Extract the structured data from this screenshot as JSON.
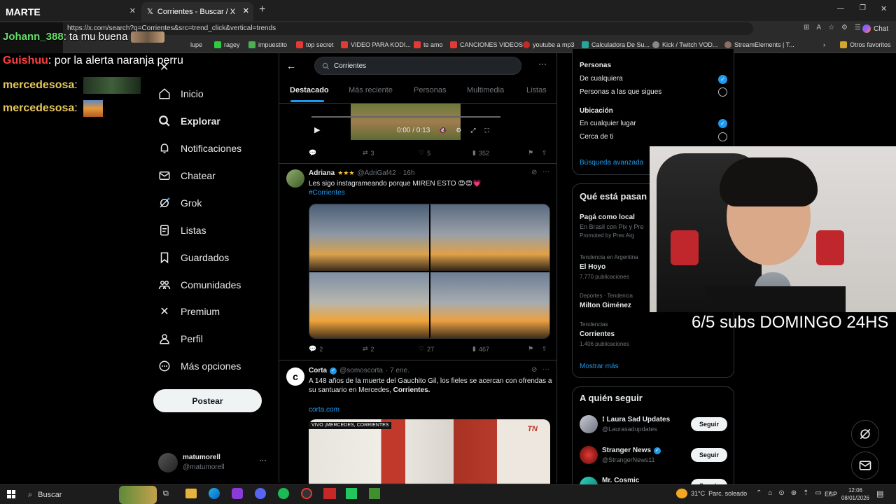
{
  "browser": {
    "tab1_title": "MARTE",
    "tab2_title": "Corrientes - Buscar / X",
    "url": "https://x.com/search?q=Corrientes&src=trend_click&vertical=trends",
    "bookmarks": [
      "lupe",
      "ragey",
      "impuestito",
      "top secret",
      "VIDEO PARA KODI...",
      "te amo",
      "CANCIONES VIDEOS",
      "youtube a mp3",
      "Calculadora De Su...",
      "Kick / Twitch VOD...",
      "StreamElements | T..."
    ],
    "other_favorites": "Otros favoritos",
    "chat_button": "Chat"
  },
  "overlay_chat": [
    {
      "user": "Johann_388",
      "text": ": ta mu buena",
      "color": "#66e06a"
    },
    {
      "user": "Guishuu",
      "text": ": por la alerta naranja perru",
      "color": "#ff4040"
    },
    {
      "user": "mercedesosa",
      "text": ":",
      "color": "#e5c75c"
    },
    {
      "user": "mercedesosa",
      "text": ":",
      "color": "#e5c75c"
    }
  ],
  "webcam_caption": "6/5 subs DOMINGO 24HS",
  "nav": {
    "items": [
      "Inicio",
      "Explorar",
      "Notificaciones",
      "Chatear",
      "Grok",
      "Listas",
      "Guardados",
      "Comunidades",
      "Premium",
      "Perfil",
      "Más opciones"
    ],
    "post_button": "Postear",
    "user_name": "matumorell",
    "user_handle": "@matumorell"
  },
  "search": {
    "query": "Corrientes",
    "tabs": [
      "Destacado",
      "Más reciente",
      "Personas",
      "Multimedia",
      "Listas"
    ]
  },
  "video": {
    "time": "0:00 / 0:13"
  },
  "tweet0_stats": {
    "retweets": "3",
    "likes": "5",
    "views": "352"
  },
  "tweet1": {
    "name": "Adriana",
    "handle": "@AdriGaf42",
    "time": "· 16h",
    "text": "Les sigo instagrameando porque MIREN ESTO 😍😍💗",
    "hashtag": "#Corrientes",
    "replies": "2",
    "retweets": "2",
    "likes": "27",
    "views": "467"
  },
  "tweet2": {
    "name": "Corta",
    "handle": "@somoscorta",
    "time": "· 7 ene.",
    "text_a": "A 148 años de la muerte del Gauchito Gil, los fieles se acercan con ofrendas a su santuario en Mercedes,",
    "text_b": "Corrientes.",
    "link": "corta.com",
    "video_banner": "VIVO ¡MERCEDES, CORRIENTES"
  },
  "filters": {
    "people_title": "Personas",
    "people_opt1": "De cualquiera",
    "people_opt2": "Personas a las que sigues",
    "location_title": "Ubicación",
    "location_opt1": "En cualquier lugar",
    "location_opt2": "Cerca de ti",
    "advanced": "Búsqueda avanzada"
  },
  "trends": {
    "title": "Qué está pasan",
    "promo_title": "Pagá como local",
    "promo_desc": "En Brasil con Pix y Pre",
    "promo_by": "Promoted by Prex Arg",
    "t1_context": "Tendencia en Argentina",
    "t1_name": "El Hoyo",
    "t1_count": "7.770 publicaciones",
    "t2_context": "Deportes · Tendencia",
    "t2_name": "Milton Giménez",
    "t3_context": "Tendencias",
    "t3_name": "Corrientes",
    "t3_count": "1.406 publicaciones",
    "show_more": "Mostrar más"
  },
  "follow": {
    "title": "A quién seguir",
    "people": [
      {
        "name": "⁝ Laura Sad Updates",
        "handle": "@Laurasadupdates",
        "button": "Seguir"
      },
      {
        "name": "Stranger News",
        "handle": "@StrangerNews11",
        "button": "Seguir"
      },
      {
        "name": "Mr. Cosmic",
        "handle": "",
        "button": "Seguir"
      }
    ]
  },
  "taskbar": {
    "search": "Buscar",
    "weather": "31°C  Parc. soleado",
    "lang": "ESP",
    "time": "12:06",
    "date": "08/01/2026"
  },
  "colors": {
    "accent": "#1d9bf0",
    "bg": "#000000",
    "border": "#2f3336",
    "muted": "#71767b"
  }
}
